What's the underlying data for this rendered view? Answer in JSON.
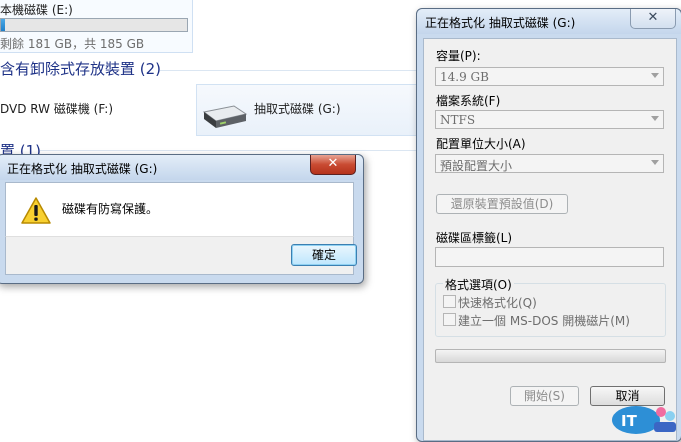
{
  "explorer": {
    "local_drive": {
      "title": "本機磁碟 (E:)",
      "free_text": "剩餘 181 GB，共 185 GB",
      "used_fraction": 0.02
    },
    "group_removable": "含有卸除式存放裝置 (2)",
    "dvd_drive": "DVD RW 磁碟機 (F:)",
    "usb_drive": "抽取式磁碟 (G:)",
    "group_other": "置 (1)"
  },
  "error_dialog": {
    "title": "正在格式化 抽取式磁碟 (G:)",
    "close_symbol": "✕",
    "message": "磁碟有防寫保護。",
    "ok_label": "確定",
    "icon": "warning-icon"
  },
  "format_dialog": {
    "title": "正在格式化 抽取式磁碟 (G:)",
    "close_symbol": "✕",
    "capacity_label": "容量(P):",
    "capacity_value": "14.9 GB",
    "filesystem_label": "檔案系統(F)",
    "filesystem_value": "NTFS",
    "alloc_label": "配置單位大小(A)",
    "alloc_value": "預設配置大小",
    "restore_label": "還原裝置預設值(D)",
    "volume_label": "磁碟區標籤(L)",
    "volume_value": "",
    "options_label": "格式選項(O)",
    "quick_format_label": "快速格式化(Q)",
    "msdos_label": "建立一個 MS-DOS 開機磁片(M)",
    "progress": 0,
    "start_label": "開始(S)",
    "cancel_label": "取消"
  },
  "colors": {
    "accent": "#1e3287",
    "titlebar": "#c4d6ec",
    "close_red": "#c94b32"
  }
}
